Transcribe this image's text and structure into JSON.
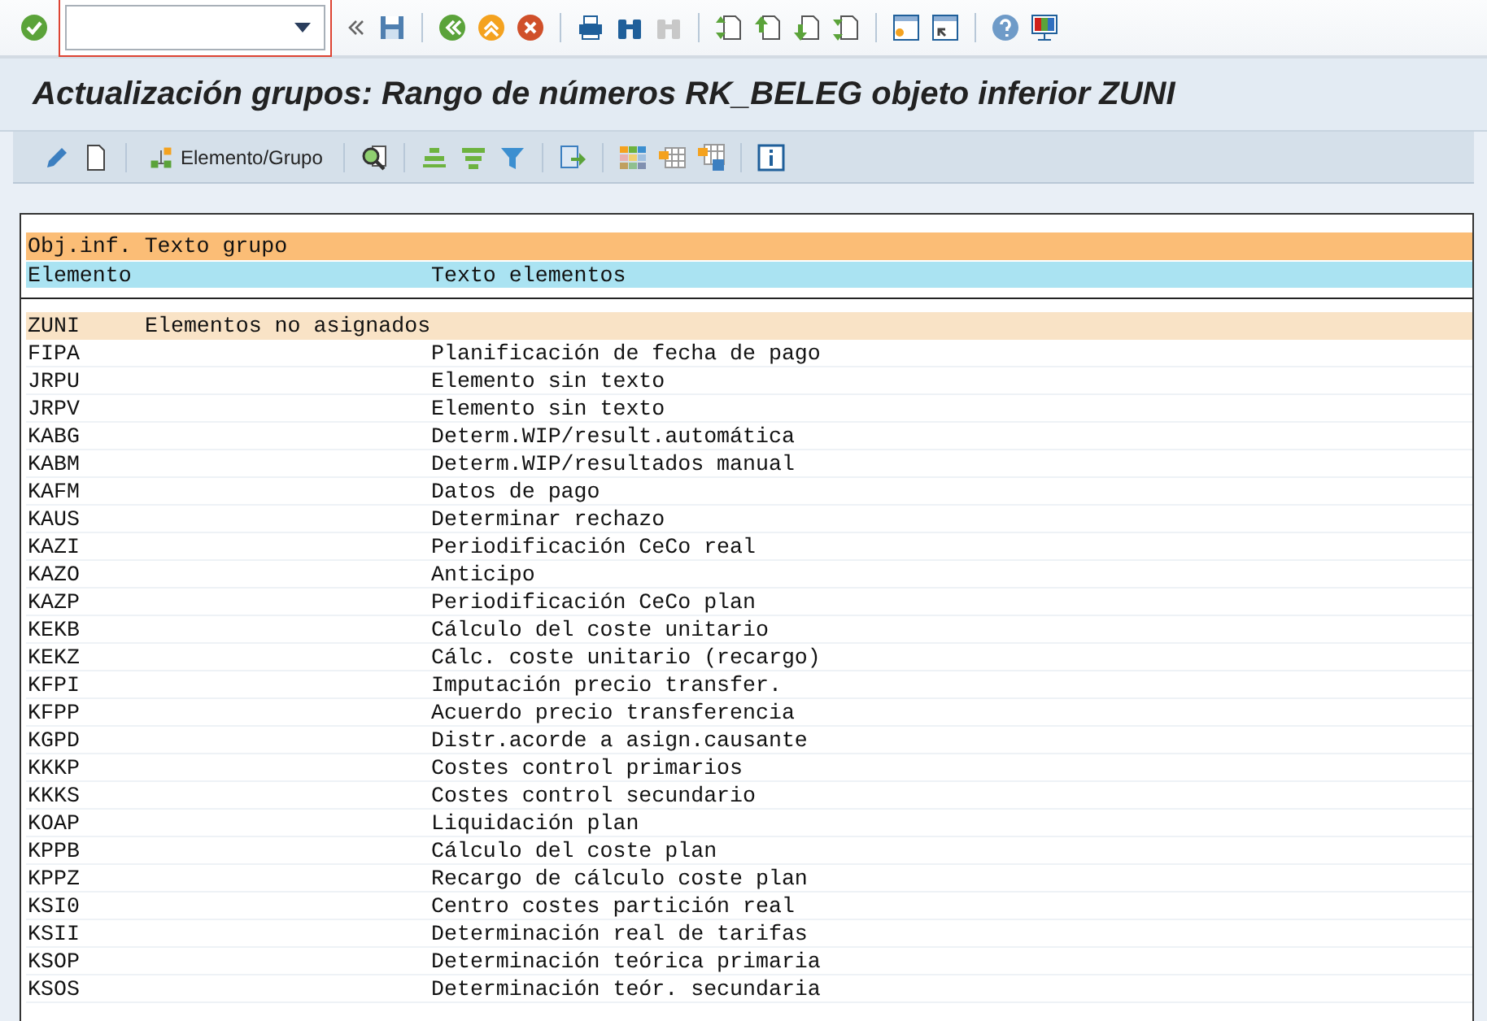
{
  "window": {
    "title": "Actualización grupos: Rango de números RK_BELEG objeto inferior ZUNI"
  },
  "app_toolbar": {
    "button_label": "Elemento/Grupo"
  },
  "list": {
    "header_group": "Obj.inf. Texto grupo",
    "columns": [
      "Elemento",
      "Texto elementos"
    ],
    "groups": [
      {
        "code": "ZUNI",
        "text": "Elementos no asignados",
        "elements": [
          {
            "code": "FIPA",
            "text": "Planificación de fecha de pago"
          },
          {
            "code": "JRPU",
            "text": "Elemento sin texto"
          },
          {
            "code": "JRPV",
            "text": "Elemento sin texto"
          },
          {
            "code": "KABG",
            "text": "Determ.WIP/result.automática"
          },
          {
            "code": "KABM",
            "text": "Determ.WIP/resultados manual"
          },
          {
            "code": "KAFM",
            "text": "Datos de pago"
          },
          {
            "code": "KAUS",
            "text": "Determinar rechazo"
          },
          {
            "code": "KAZI",
            "text": "Periodificación CeCo real"
          },
          {
            "code": "KAZO",
            "text": "Anticipo"
          },
          {
            "code": "KAZP",
            "text": "Periodificación CeCo plan"
          },
          {
            "code": "KEKB",
            "text": "Cálculo del coste unitario"
          },
          {
            "code": "KEKZ",
            "text": "Cálc. coste unitario (recargo)"
          },
          {
            "code": "KFPI",
            "text": "Imputación precio transfer."
          },
          {
            "code": "KFPP",
            "text": "Acuerdo precio transferencia"
          },
          {
            "code": "KGPD",
            "text": "Distr.acorde a asign.causante"
          },
          {
            "code": "KKKP",
            "text": "Costes control primarios"
          },
          {
            "code": "KKKS",
            "text": "Costes control secundario"
          },
          {
            "code": "KOAP",
            "text": "Liquidación plan"
          },
          {
            "code": "KPPB",
            "text": "Cálculo del coste plan"
          },
          {
            "code": "KPPZ",
            "text": "Recargo de cálculo coste plan"
          },
          {
            "code": "KSI0",
            "text": "Centro costes partición real"
          },
          {
            "code": "KSII",
            "text": "Determinación real de tarifas"
          },
          {
            "code": "KSOP",
            "text": "Determinación teórica primaria"
          },
          {
            "code": "KSOS",
            "text": "Determinación teór. secundaria"
          }
        ]
      }
    ]
  }
}
